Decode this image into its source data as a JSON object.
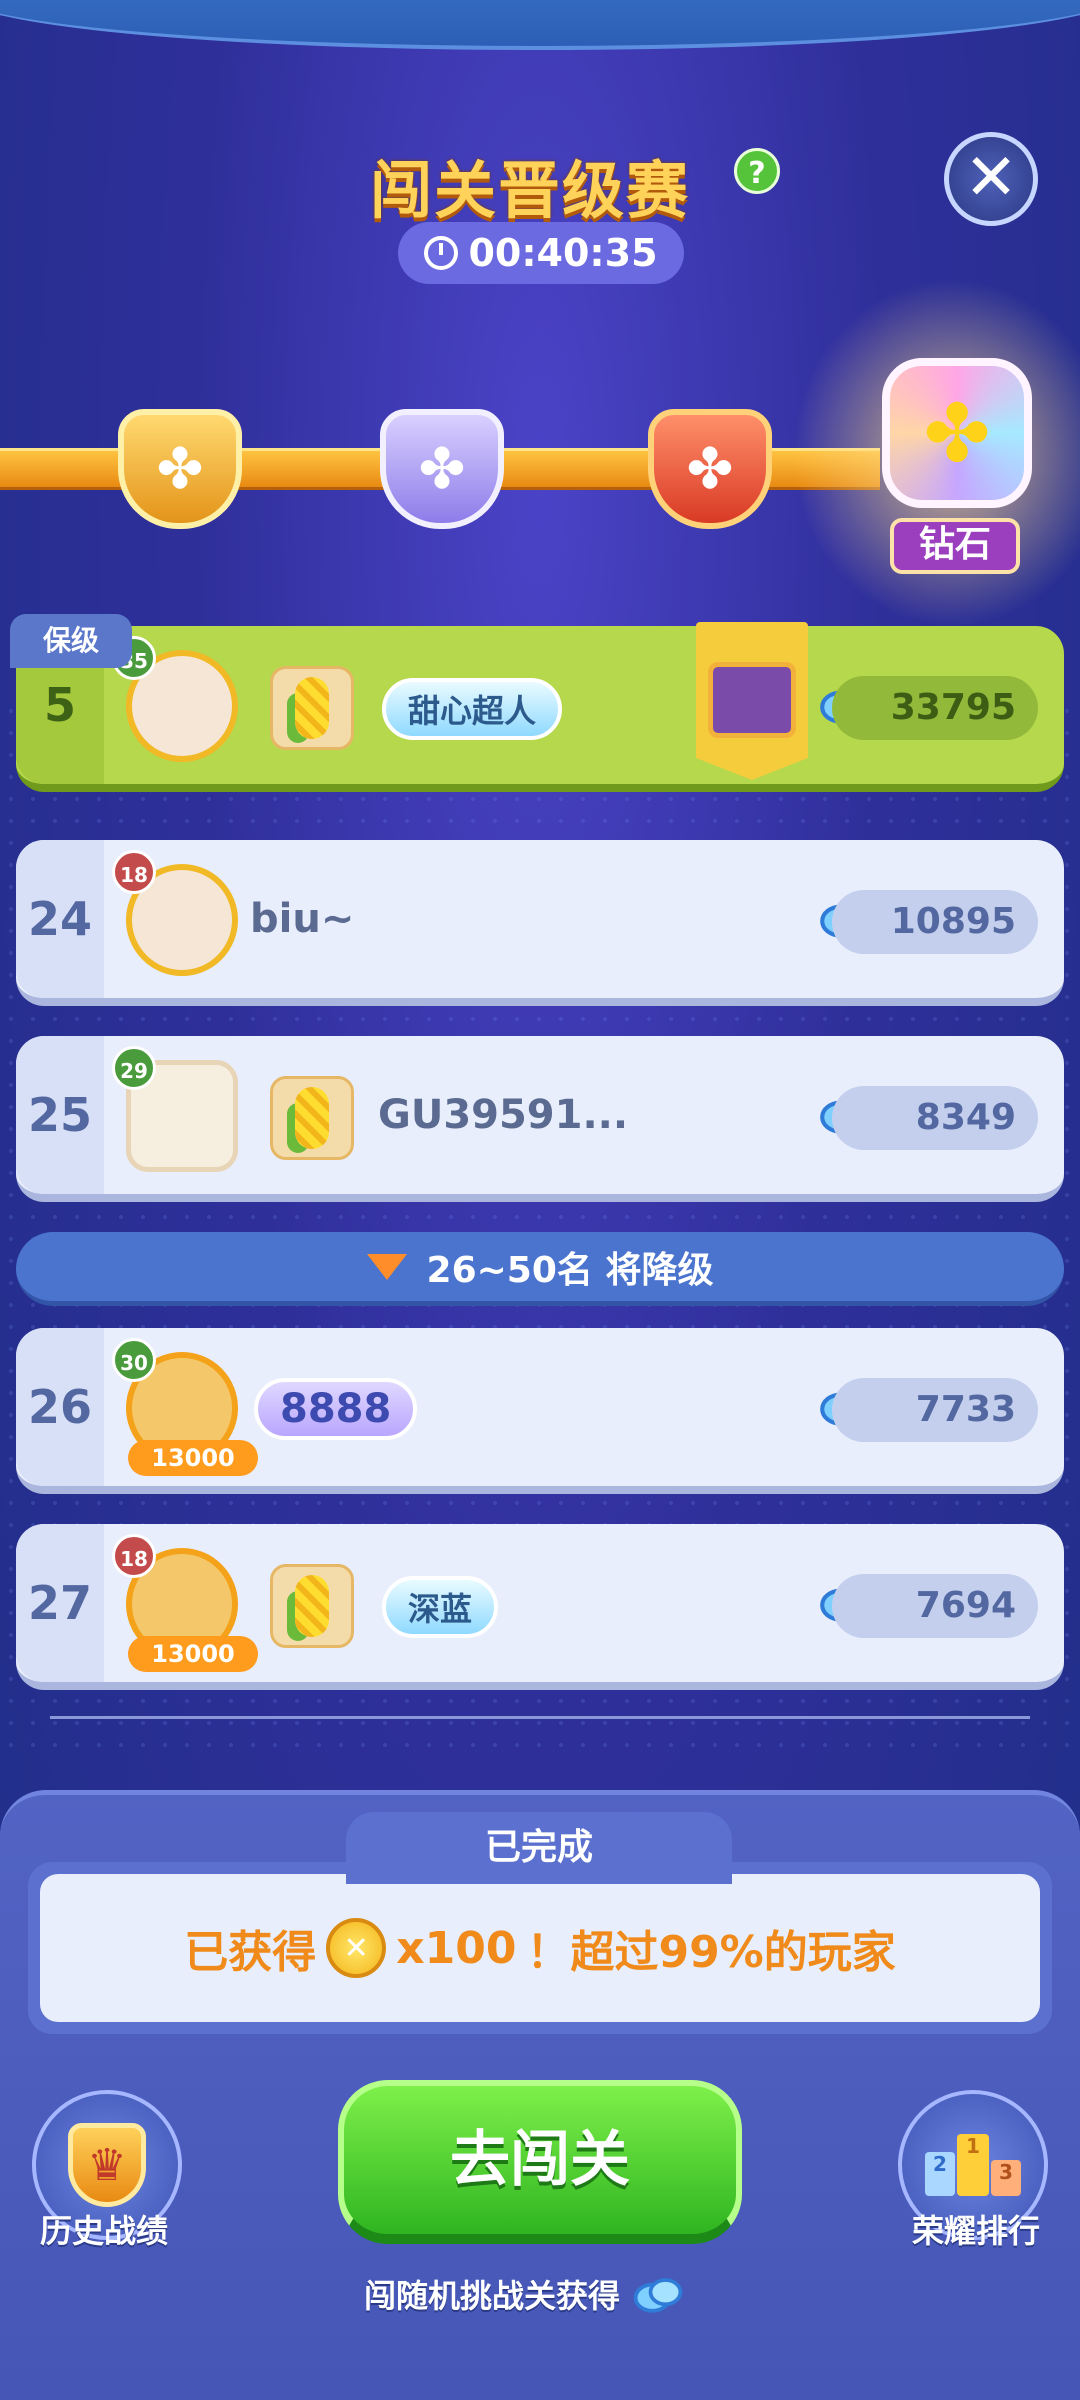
{
  "header": {
    "title": "闯关晋级赛",
    "help_label": "?",
    "close_label": "✕",
    "timer": "00:40:35"
  },
  "tiers": {
    "current_tier": "钻石"
  },
  "leaderboard": {
    "protect_tag": "保级",
    "rows": [
      {
        "rank": "5",
        "level": "35",
        "name": "甜心超人",
        "score": "33795"
      },
      {
        "rank": "24",
        "level": "18",
        "name": "biu~",
        "score": "10895"
      },
      {
        "rank": "25",
        "level": "29",
        "name": "GU39591...",
        "score": "8349"
      },
      {
        "rank": "26",
        "level": "30",
        "name": "8888",
        "score": "7733",
        "frame_label": "13000"
      },
      {
        "rank": "27",
        "level": "18",
        "name": "深蓝",
        "score": "7694",
        "frame_label": "13000"
      }
    ],
    "demotion_banner": "26~50名 将降级"
  },
  "completion": {
    "tab": "已完成",
    "prefix": "已获得",
    "amount": "x100",
    "suffix": "！超过99%的玩家"
  },
  "actions": {
    "history": "历史战绩",
    "go": "去闯关",
    "ranking": "荣耀排行",
    "hint": "闯随机挑战关获得"
  },
  "colors": {
    "accent_green": "#2fb520",
    "highlight_row": "#b6d84c",
    "title_gold": "#ffd25a"
  }
}
